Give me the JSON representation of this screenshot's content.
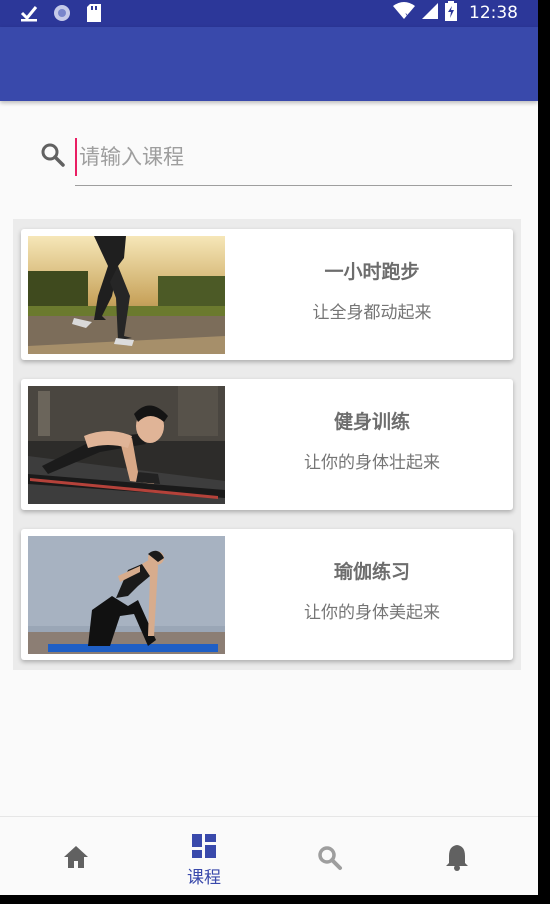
{
  "status_bar": {
    "time": "12:38"
  },
  "search": {
    "placeholder": "请输入课程"
  },
  "courses": [
    {
      "title": "一小时跑步",
      "subtitle": "让全身都动起来",
      "image": "running-photo"
    },
    {
      "title": "健身训练",
      "subtitle": "让你的身体壮起来",
      "image": "plank-photo"
    },
    {
      "title": "瑜伽练习",
      "subtitle": "让你的身体美起来",
      "image": "yoga-photo"
    }
  ],
  "bottom_nav": {
    "items": [
      {
        "icon": "home-icon",
        "label": ""
      },
      {
        "icon": "dashboard-icon",
        "label": "课程",
        "active": true
      },
      {
        "icon": "search-icon",
        "label": ""
      },
      {
        "icon": "bell-icon",
        "label": ""
      }
    ]
  },
  "colors": {
    "primary": "#3949ab",
    "status_bar": "#2c3799",
    "cursor": "#e91e63"
  }
}
